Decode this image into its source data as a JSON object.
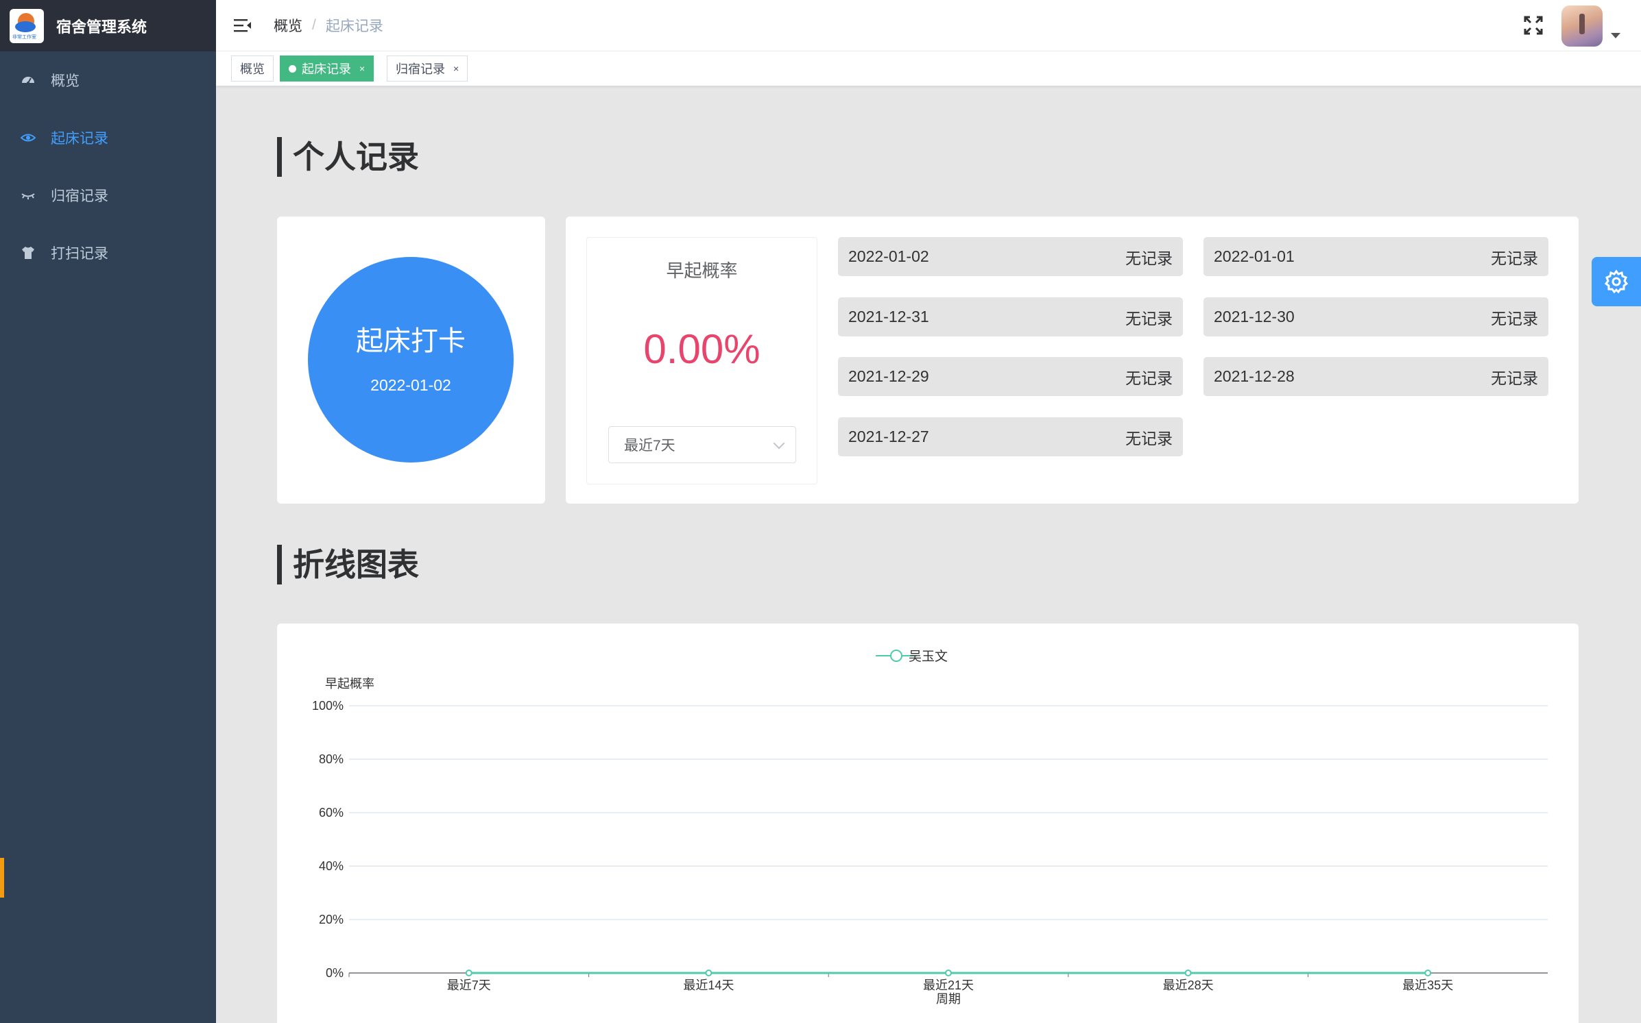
{
  "app": {
    "title": "宿舍管理系统",
    "logo_text": "非常工作室"
  },
  "sidebar": {
    "items": [
      {
        "label": "概览",
        "icon": "dashboard-icon",
        "active": false
      },
      {
        "label": "起床记录",
        "icon": "eye-icon",
        "active": true
      },
      {
        "label": "归宿记录",
        "icon": "closed-eye-icon",
        "active": false
      },
      {
        "label": "打扫记录",
        "icon": "shirt-icon",
        "active": false
      }
    ]
  },
  "header": {
    "breadcrumb": [
      "概览",
      "起床记录"
    ],
    "breadcrumb_separator": "/"
  },
  "tags": [
    {
      "label": "概览",
      "active": false
    },
    {
      "label": "起床记录",
      "active": true,
      "close": "×"
    },
    {
      "label": "归宿记录",
      "active": false,
      "close": "×"
    }
  ],
  "section_personal": {
    "title": "个人记录"
  },
  "checkin": {
    "label": "起床打卡",
    "date": "2022-01-02"
  },
  "rate": {
    "title": "早起概率",
    "value": "0.00%",
    "range_selected": "最近7天"
  },
  "records": [
    {
      "date": "2022-01-02",
      "status": "无记录"
    },
    {
      "date": "2022-01-01",
      "status": "无记录"
    },
    {
      "date": "2021-12-31",
      "status": "无记录"
    },
    {
      "date": "2021-12-30",
      "status": "无记录"
    },
    {
      "date": "2021-12-29",
      "status": "无记录"
    },
    {
      "date": "2021-12-28",
      "status": "无记录"
    },
    {
      "date": "2021-12-27",
      "status": "无记录"
    }
  ],
  "section_chart": {
    "title": "折线图表"
  },
  "chart_data": {
    "type": "line",
    "legend_position": "top-center",
    "ylabel": "早起概率",
    "xlabel": "周期",
    "categories": [
      "最近7天",
      "最近14天",
      "最近21天",
      "最近28天",
      "最近35天"
    ],
    "y_ticks": [
      "0%",
      "20%",
      "40%",
      "60%",
      "80%",
      "100%"
    ],
    "ylim": [
      0,
      100
    ],
    "grid": true,
    "series": [
      {
        "name": "吴玉文",
        "color": "#4ecbac",
        "values": [
          0,
          0,
          0,
          0,
          0
        ]
      }
    ]
  },
  "colors": {
    "accent": "#409eff",
    "tag_active": "#42b983",
    "rate_value": "#e8456c",
    "checkin": "#3a8ff5"
  }
}
